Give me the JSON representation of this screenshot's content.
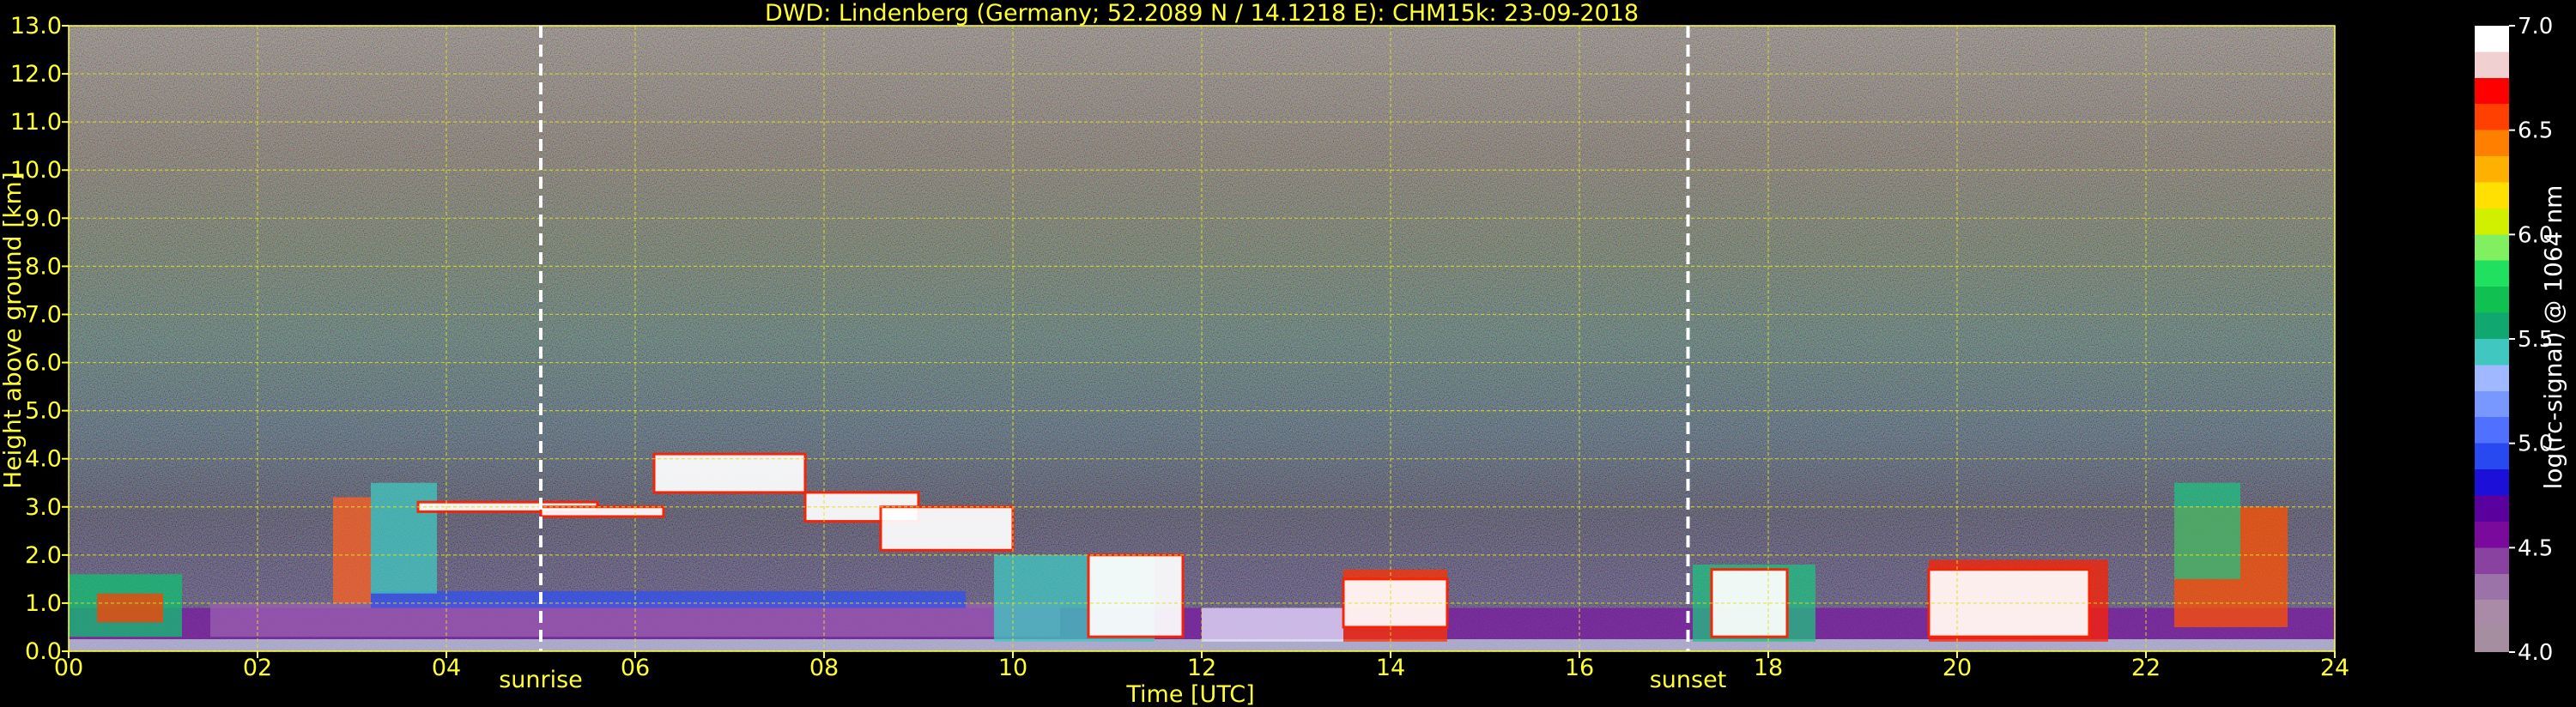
{
  "chart_data": {
    "type": "heatmap",
    "title": "DWD: Lindenberg (Germany; 52.2089 N / 14.1218 E):    CHM15k: 23-09-2018",
    "xlabel": "Time [UTC]",
    "ylabel": "Height above ground [km]",
    "x_ticks": [
      "00",
      "02",
      "04",
      "06",
      "08",
      "10",
      "12",
      "14",
      "16",
      "18",
      "20",
      "22",
      "24"
    ],
    "y_ticks": [
      "0.0",
      "1.0",
      "2.0",
      "3.0",
      "4.0",
      "5.0",
      "6.0",
      "7.0",
      "8.0",
      "9.0",
      "10.0",
      "11.0",
      "12.0",
      "13.0"
    ],
    "xlim": [
      0,
      24
    ],
    "ylim": [
      0,
      13
    ],
    "grid": true,
    "annotations": [
      {
        "label": "sunrise",
        "x": 5.0
      },
      {
        "label": "sunset",
        "x": 17.15
      }
    ],
    "colorbar": {
      "label": "log(rc-signal) @ 1064 nm",
      "ticks": [
        "4.0",
        "4.5",
        "5.0",
        "5.5",
        "6.0",
        "6.5",
        "7.0"
      ],
      "range": [
        4.0,
        7.0
      ],
      "colors": [
        "#a48ea0",
        "#a98ba8",
        "#9c73a8",
        "#8a42a0",
        "#7a0a9c",
        "#5a009c",
        "#1c10d8",
        "#2848f0",
        "#5070ff",
        "#7898ff",
        "#a0b8ff",
        "#40c8c0",
        "#10a870",
        "#10c050",
        "#20e060",
        "#80f060",
        "#d0f000",
        "#ffe000",
        "#ffb000",
        "#ff8000",
        "#ff4000",
        "#ff0000",
        "#f0d0d0",
        "#ffffff"
      ]
    },
    "cloud_layers": [
      {
        "x": [
          3.7,
          5.6
        ],
        "y": [
          2.9,
          3.1
        ]
      },
      {
        "x": [
          5.0,
          6.3
        ],
        "y": [
          2.8,
          3.0
        ]
      },
      {
        "x": [
          6.2,
          7.8
        ],
        "y": [
          3.3,
          4.1
        ]
      },
      {
        "x": [
          7.8,
          9.0
        ],
        "y": [
          2.7,
          3.3
        ]
      },
      {
        "x": [
          8.6,
          10.0
        ],
        "y": [
          2.1,
          3.0
        ]
      },
      {
        "x": [
          10.8,
          11.8
        ],
        "y": [
          0.3,
          2.0
        ]
      },
      {
        "x": [
          13.5,
          14.6
        ],
        "y": [
          0.5,
          1.5
        ]
      },
      {
        "x": [
          17.4,
          18.2
        ],
        "y": [
          0.3,
          1.7
        ]
      },
      {
        "x": [
          19.7,
          21.4
        ],
        "y": [
          0.3,
          1.7
        ]
      }
    ]
  }
}
